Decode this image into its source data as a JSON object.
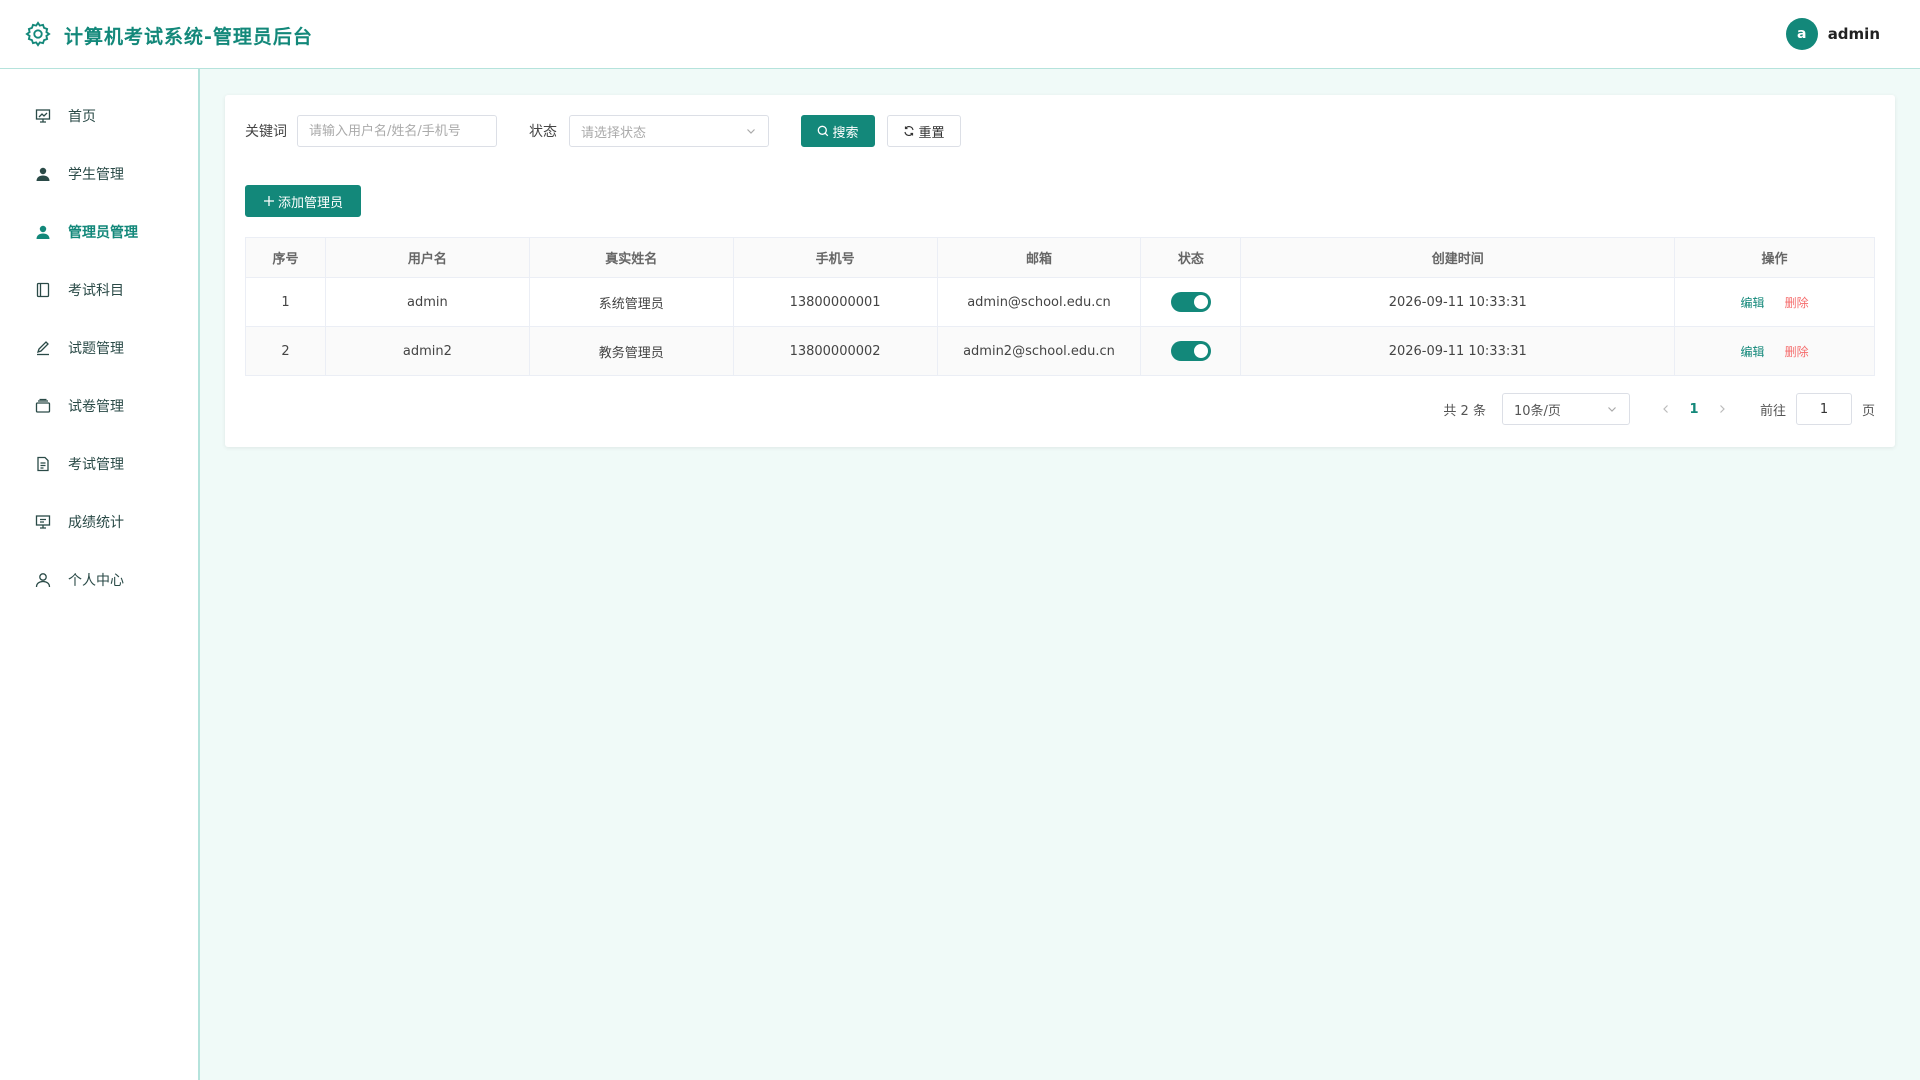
{
  "header": {
    "title": "计算机考试系统-管理员后台",
    "avatar_letter": "a",
    "username": "admin"
  },
  "sidebar": {
    "items": [
      {
        "label": "首页",
        "icon": "dashboard-icon"
      },
      {
        "label": "学生管理",
        "icon": "user-filled-icon"
      },
      {
        "label": "管理员管理",
        "icon": "user-filled-icon",
        "active": true
      },
      {
        "label": "考试科目",
        "icon": "notebook-icon"
      },
      {
        "label": "试题管理",
        "icon": "edit-pen-icon"
      },
      {
        "label": "试卷管理",
        "icon": "folder-stack-icon"
      },
      {
        "label": "考试管理",
        "icon": "document-icon"
      },
      {
        "label": "成绩统计",
        "icon": "presentation-icon"
      },
      {
        "label": "个人中心",
        "icon": "user-outline-icon"
      }
    ]
  },
  "filter": {
    "keyword_label": "关键词",
    "keyword_placeholder": "请输入用户名/姓名/手机号",
    "status_label": "状态",
    "status_placeholder": "请选择状态",
    "search_label": "搜索",
    "reset_label": "重置"
  },
  "add_button_label": "添加管理员",
  "table": {
    "columns": [
      "序号",
      "用户名",
      "真实姓名",
      "手机号",
      "邮箱",
      "状态",
      "创建时间",
      "操作"
    ],
    "rows": [
      {
        "index": "1",
        "username": "admin",
        "realname": "系统管理员",
        "phone": "13800000001",
        "email": "admin@school.edu.cn",
        "status_on": true,
        "created": "2026-09-11 10:33:31"
      },
      {
        "index": "2",
        "username": "admin2",
        "realname": "教务管理员",
        "phone": "13800000002",
        "email": "admin2@school.edu.cn",
        "status_on": true,
        "created": "2026-09-11 10:33:31"
      }
    ],
    "edit_label": "编辑",
    "delete_label": "删除"
  },
  "pagination": {
    "total_text": "共 2 条",
    "page_size": "10条/页",
    "current_page": "1",
    "goto_label": "前往",
    "goto_value": "1",
    "page_suffix": "页"
  },
  "colors": {
    "accent": "#13887a",
    "danger": "#f56c6c",
    "background": "#f0faf8"
  }
}
